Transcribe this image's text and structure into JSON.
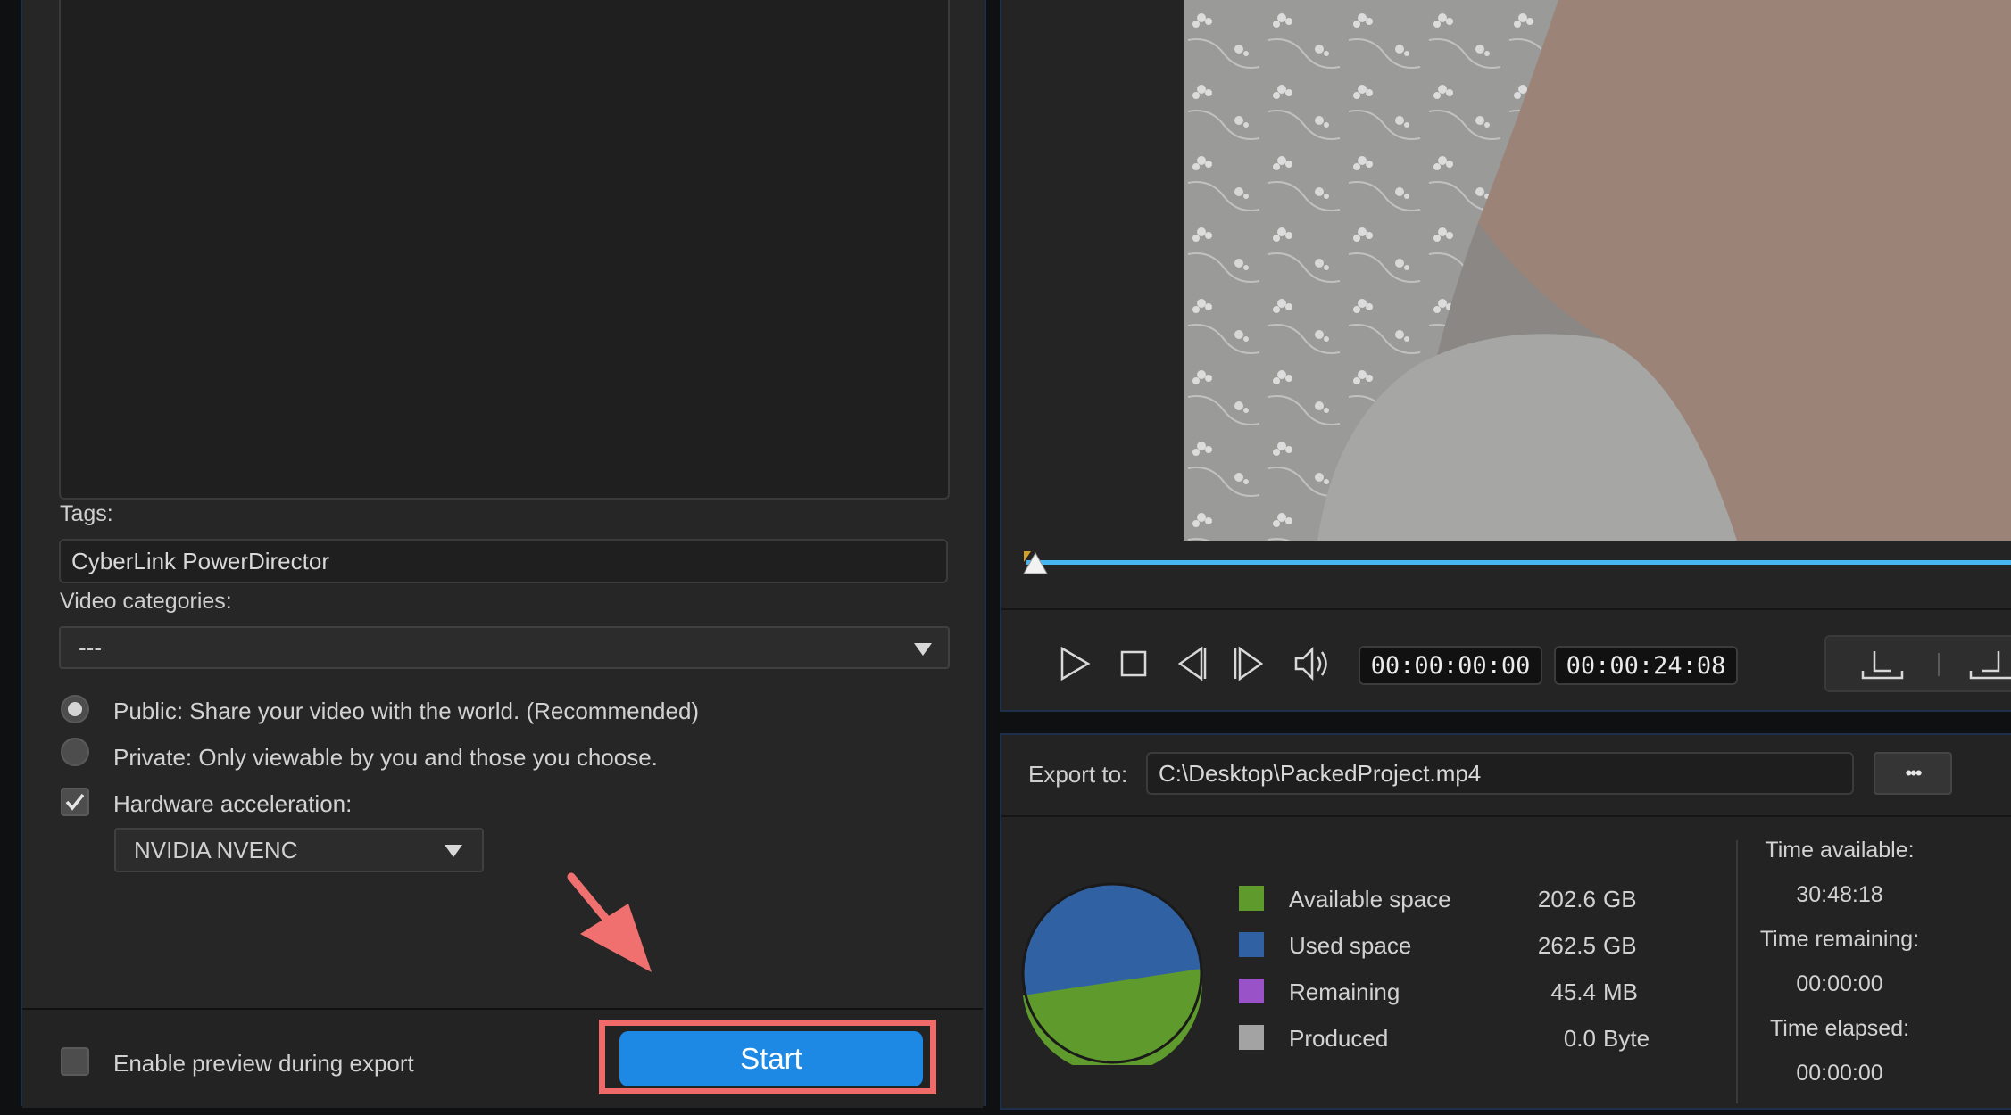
{
  "upload_form": {
    "tags_label": "Tags:",
    "tags_value": "CyberLink PowerDirector",
    "categories_label": "Video categories:",
    "categories_value": "---",
    "privacy_public": "Public: Share your video with the world. (Recommended)",
    "privacy_private": "Private: Only viewable by you and those you choose.",
    "hw_accel_label": "Hardware acceleration:",
    "hw_accel_value": "NVIDIA NVENC",
    "enable_preview_label": "Enable preview during export",
    "start_label": "Start"
  },
  "player": {
    "current_time": "00:00:00:00",
    "duration": "00:00:24:08",
    "progress": 0
  },
  "export": {
    "label": "Export to:",
    "path": "C:\\Desktop\\PackedProject.mp4",
    "browse_label": "•••",
    "legend": [
      {
        "label": "Available space",
        "value": "202.6",
        "unit": "GB",
        "color": "#5f9b2c"
      },
      {
        "label": "Used space",
        "value": "262.5",
        "unit": "GB",
        "color": "#3062a3"
      },
      {
        "label": "Remaining",
        "value": "45.4",
        "unit": "MB",
        "color": "#9a52c9"
      },
      {
        "label": "Produced",
        "value": "0.0",
        "unit": "Byte",
        "color": "#a3a3a3"
      }
    ],
    "time_available_label": "Time available:",
    "time_available": "30:48:18",
    "time_remaining_label": "Time remaining:",
    "time_remaining": "00:00:00",
    "time_elapsed_label": "Time elapsed:",
    "time_elapsed": "00:00:00"
  },
  "colors": {
    "accent": "#1e88e5",
    "highlight": "#f06a6a",
    "progress": "#47b5f0"
  }
}
